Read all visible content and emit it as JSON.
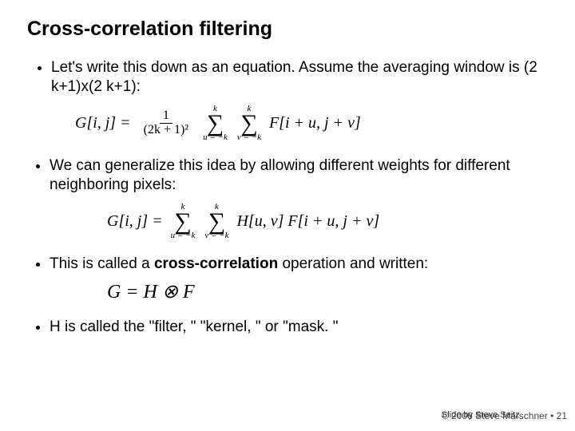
{
  "title": "Cross-correlation filtering",
  "bullets": {
    "b1_a": "Let's write this down as an equation.  Assume the averaging window is (2 k+1)x(2 k+1):",
    "b2_a": "We can generalize this idea by allowing different weights for different neighboring pixels:",
    "b3_a": "This is called a ",
    "b3_bold": "cross-correlation",
    "b3_b": " operation and written:",
    "b4": "H is called the \"filter, \"  \"kernel, \"  or \"mask. \""
  },
  "formulas": {
    "f1_lhs": "G[i, j] =",
    "f1_frac_num": "1",
    "f1_frac_den": "(2k + 1)²",
    "f1_sum1_top": "k",
    "f1_sum1_bot": "u = −k",
    "f1_sum2_top": "k",
    "f1_sum2_bot": "v = −k",
    "f1_rhs": "F[i + u, j + v]",
    "f2_lhs": "G[i, j] =",
    "f2_sum1_top": "k",
    "f2_sum1_bot": "u = −k",
    "f2_sum2_top": "k",
    "f2_sum2_bot": "v = −k",
    "f2_rhs": "H[u, v] F[i + u, j + v]",
    "f3": "G = H ⊗ F"
  },
  "footer": {
    "line1a": "© 2006 Steve Marschner • 21",
    "line1b": "Slide by Steve Seitz"
  }
}
